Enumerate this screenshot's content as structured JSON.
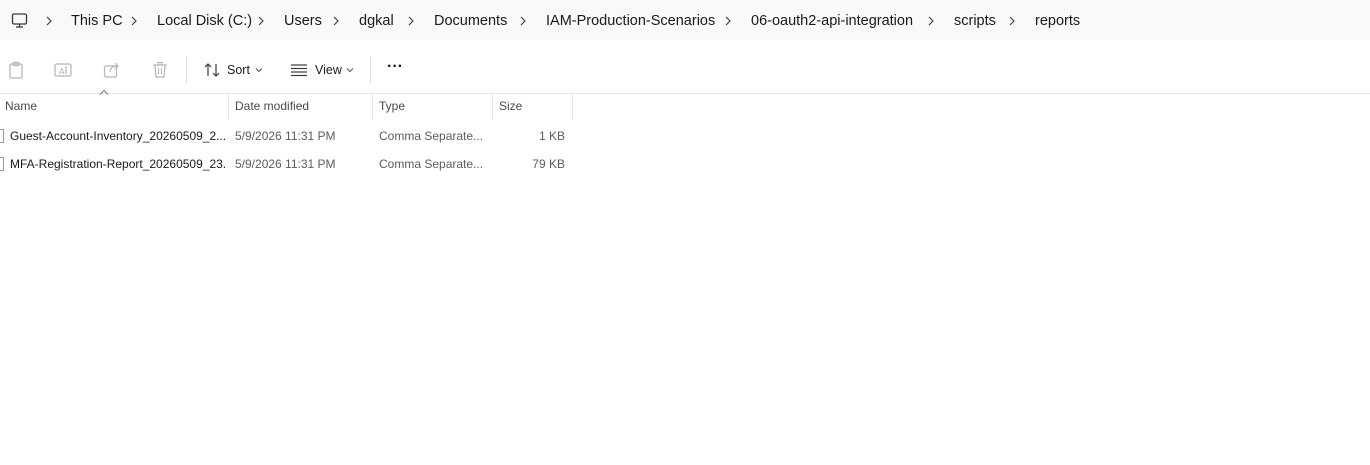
{
  "breadcrumb": {
    "root_icon": "computer-icon",
    "items": [
      "This PC",
      "Local Disk (C:)",
      "Users",
      "dgkal",
      "Documents",
      "IAM-Production-Scenarios",
      "06-oauth2-api-integration",
      "scripts",
      "reports"
    ]
  },
  "commandbar": {
    "icons": [
      "paste-icon",
      "rename-icon",
      "share-icon",
      "delete-icon"
    ],
    "sort_label": "Sort",
    "view_label": "View",
    "more_label": "···"
  },
  "columns": {
    "name": "Name",
    "date": "Date modified",
    "type": "Type",
    "size": "Size"
  },
  "files": [
    {
      "name": "Guest-Account-Inventory_20260509_2...",
      "date": "5/9/2026 11:31 PM",
      "type": "Comma Separate...",
      "size": "1 KB"
    },
    {
      "name": "MFA-Registration-Report_20260509_23...",
      "date": "5/9/2026 11:31 PM",
      "type": "Comma Separate...",
      "size": "79 KB"
    }
  ],
  "colors": {
    "address_bg": "#f9f9f9",
    "text": "#1a1a1a",
    "muted_text": "#5c5c5c",
    "disabled_icon": "#b5b5b5"
  }
}
